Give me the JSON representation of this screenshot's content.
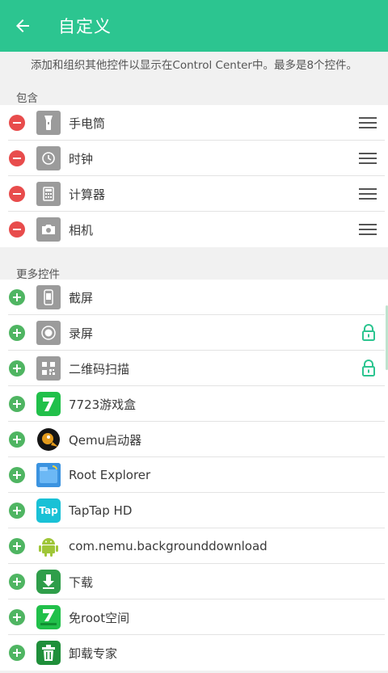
{
  "header": {
    "title": "自定义",
    "back_icon": "arrow-left-icon",
    "bg_color": "#2cc590"
  },
  "description": "添加和组织其他控件以显示在Control Center中。最多是8个控件。",
  "included": {
    "label": "包含",
    "items": [
      {
        "label": "手电筒",
        "icon": "flashlight-icon"
      },
      {
        "label": "时钟",
        "icon": "clock-icon"
      },
      {
        "label": "计算器",
        "icon": "calculator-icon"
      },
      {
        "label": "相机",
        "icon": "camera-icon"
      }
    ]
  },
  "more": {
    "label": "更多控件",
    "items": [
      {
        "label": "截屏",
        "icon": "screenshot-icon",
        "locked": false
      },
      {
        "label": "录屏",
        "icon": "screen-record-icon",
        "locked": true
      },
      {
        "label": "二维码扫描",
        "icon": "qr-scan-icon",
        "locked": true
      },
      {
        "label": "7723游戏盒",
        "icon": "app-7723-icon",
        "locked": false
      },
      {
        "label": "Qemu启动器",
        "icon": "qemu-icon",
        "locked": false
      },
      {
        "label": "Root Explorer",
        "icon": "root-explorer-icon",
        "locked": false
      },
      {
        "label": "TapTap HD",
        "icon": "taptap-icon",
        "locked": false,
        "icon_text": "Tap"
      },
      {
        "label": "com.nemu.backgrounddownload",
        "icon": "android-icon",
        "locked": false
      },
      {
        "label": "下载",
        "icon": "download-icon",
        "locked": false
      },
      {
        "label": "免root空间",
        "icon": "app-7723-space-icon",
        "locked": false
      },
      {
        "label": "卸载专家",
        "icon": "uninstall-icon",
        "locked": false
      }
    ]
  },
  "colors": {
    "remove": "#e84c4c",
    "add": "#4fb562",
    "lock": "#2cc590"
  }
}
